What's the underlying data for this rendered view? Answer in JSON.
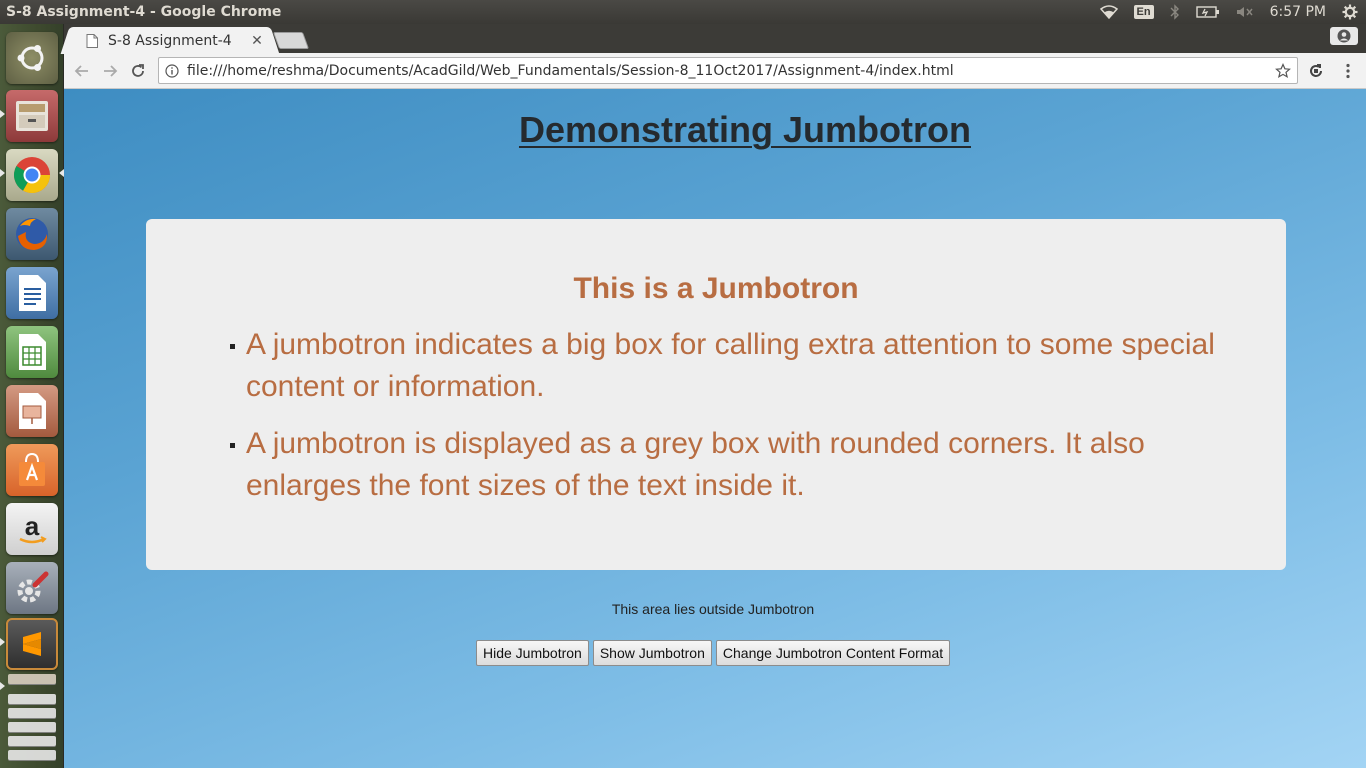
{
  "top_panel": {
    "window_title": "S-8 Assignment-4 - Google Chrome",
    "keyboard_layout": "En",
    "clock": "6:57 PM",
    "tray_icons": [
      "wifi-icon",
      "keyboard-layout-icon",
      "bluetooth-icon",
      "battery-icon",
      "volume-muted-icon",
      "settings-gear-icon"
    ]
  },
  "launcher": {
    "items": [
      {
        "name": "ubuntu-dash",
        "icon": "ubuntu-logo-icon"
      },
      {
        "name": "files",
        "icon": "file-cabinet-icon"
      },
      {
        "name": "google-chrome",
        "icon": "chrome-icon"
      },
      {
        "name": "firefox",
        "icon": "firefox-icon"
      },
      {
        "name": "libreoffice-writer",
        "icon": "writer-icon"
      },
      {
        "name": "libreoffice-calc",
        "icon": "calc-icon"
      },
      {
        "name": "libreoffice-impress",
        "icon": "impress-icon"
      },
      {
        "name": "software-center",
        "icon": "shopping-bag-icon"
      },
      {
        "name": "amazon",
        "icon": "amazon-icon"
      },
      {
        "name": "system-settings",
        "icon": "wrench-gear-icon"
      },
      {
        "name": "sublime-text",
        "icon": "sublime-icon"
      },
      {
        "name": "text-editor",
        "icon": "text-editor-icon"
      },
      {
        "name": "trash",
        "icon": "trash-icon"
      }
    ]
  },
  "browser": {
    "tab_title": "S-8 Assignment-4",
    "url": "file:///home/reshma/Documents/AcadGild/Web_Fundamentals/Session-8_11Oct2017/Assignment-4/index.html"
  },
  "page": {
    "heading": "Demonstrating Jumbotron",
    "jumbotron": {
      "title": "This is a Jumbotron",
      "items": [
        "A jumbotron indicates a big box for calling extra attention to some special content or information.",
        "A jumbotron is displayed as a grey box with rounded corners. It also enlarges the font sizes of the text inside it."
      ]
    },
    "outside_text": "This area lies outside Jumbotron",
    "buttons": {
      "hide": "Hide Jumbotron",
      "show": "Show Jumbotron",
      "change": "Change Jumbotron Content Format"
    }
  },
  "colors": {
    "jumbotron_text": "#b86d42",
    "jumbotron_bg": "#eeeeee",
    "page_bg_start": "#3e8dc2",
    "page_bg_end": "#a3d4f4"
  }
}
